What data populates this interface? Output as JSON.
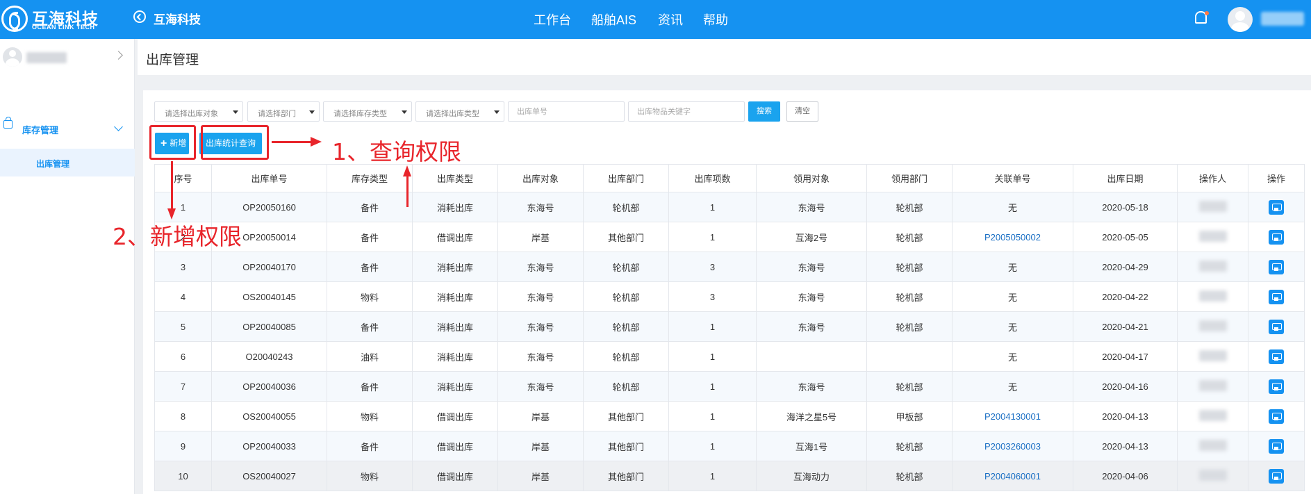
{
  "header": {
    "brand_cn": "互海科技",
    "brand_en": "OCEAN LINK TECH",
    "system_title": "互海科技",
    "nav": [
      "工作台",
      "船舶AIS",
      "资讯",
      "帮助"
    ]
  },
  "sidebar": {
    "group_label": "库存管理",
    "active_item": "出库管理"
  },
  "page": {
    "title": "出库管理"
  },
  "filters": {
    "target": "请选择出库对象",
    "department": "请选择部门",
    "stock_type": "请选择库存类型",
    "outbound_type": "请选择出库类型",
    "order_no_placeholder": "出库单号",
    "keyword_placeholder": "出库物品关键字",
    "search_label": "搜索",
    "clear_label": "清空"
  },
  "actions": {
    "add_label": "新增",
    "stats_label": "出库统计查询"
  },
  "annotations": {
    "query_permission": "1、查询权限",
    "add_permission": "2、新增权限"
  },
  "table": {
    "columns": [
      "序号",
      "出库单号",
      "库存类型",
      "出库类型",
      "出库对象",
      "出库部门",
      "出库项数",
      "领用对象",
      "领用部门",
      "关联单号",
      "出库日期",
      "操作人",
      "操作"
    ],
    "rows": [
      [
        "1",
        "OP20050160",
        "备件",
        "消耗出库",
        "东海号",
        "轮机部",
        "1",
        "东海号",
        "轮机部",
        "无",
        "2020-05-18"
      ],
      [
        "2",
        "OP20050014",
        "备件",
        "借调出库",
        "岸基",
        "其他部门",
        "1",
        "互海2号",
        "轮机部",
        "P2005050002",
        "2020-05-05"
      ],
      [
        "3",
        "OP20040170",
        "备件",
        "消耗出库",
        "东海号",
        "轮机部",
        "3",
        "东海号",
        "轮机部",
        "无",
        "2020-04-29"
      ],
      [
        "4",
        "OS20040145",
        "物料",
        "消耗出库",
        "东海号",
        "轮机部",
        "3",
        "东海号",
        "轮机部",
        "无",
        "2020-04-22"
      ],
      [
        "5",
        "OP20040085",
        "备件",
        "消耗出库",
        "东海号",
        "轮机部",
        "1",
        "东海号",
        "轮机部",
        "无",
        "2020-04-21"
      ],
      [
        "6",
        "O20040243",
        "油料",
        "消耗出库",
        "东海号",
        "轮机部",
        "1",
        "",
        "",
        "无",
        "2020-04-17"
      ],
      [
        "7",
        "OP20040036",
        "备件",
        "消耗出库",
        "东海号",
        "轮机部",
        "1",
        "东海号",
        "轮机部",
        "无",
        "2020-04-16"
      ],
      [
        "8",
        "OS20040055",
        "物料",
        "借调出库",
        "岸基",
        "其他部门",
        "1",
        "海洋之星5号",
        "甲板部",
        "P2004130001",
        "2020-04-13"
      ],
      [
        "9",
        "OP20040033",
        "备件",
        "借调出库",
        "岸基",
        "其他部门",
        "1",
        "互海1号",
        "轮机部",
        "P2003260003",
        "2020-04-13"
      ],
      [
        "10",
        "OS20040027",
        "物料",
        "借调出库",
        "岸基",
        "其他部门",
        "1",
        "互海动力",
        "轮机部",
        "P2004060001",
        "2020-04-06"
      ]
    ]
  },
  "colors": {
    "brand_blue": "#1592f1",
    "button_blue": "#1aa3ee",
    "annotation_red": "#e8252b",
    "link_blue": "#1a6fc4"
  }
}
